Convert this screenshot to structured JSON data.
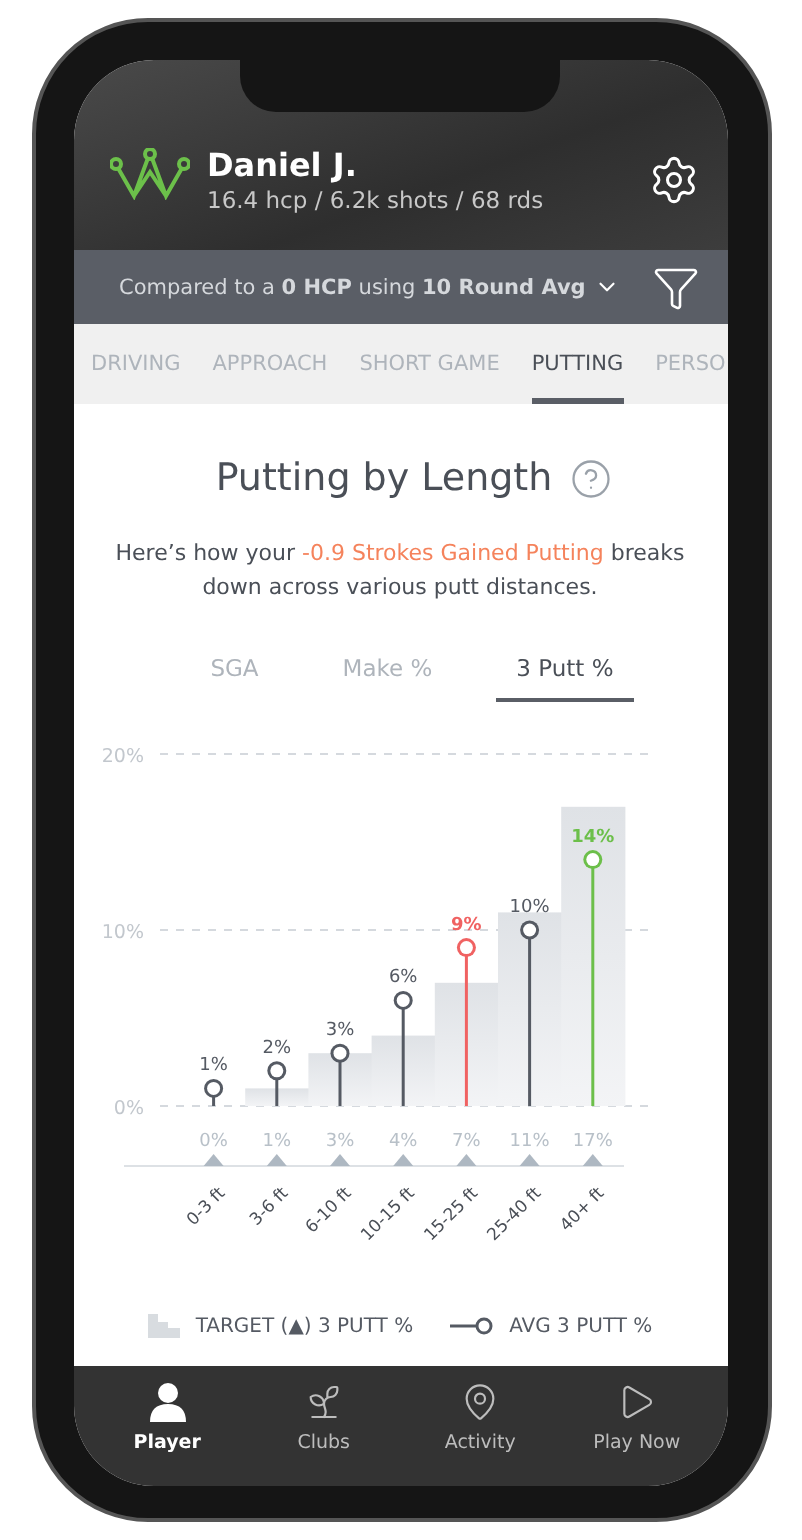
{
  "header": {
    "name": "Daniel J.",
    "stats": "16.4 hcp / 6.2k shots / 68 rds"
  },
  "comparison": {
    "text": "Compared to a **0 HCP** using **10 Round Avg**"
  },
  "tabs": [
    {
      "label": "DRIVING",
      "selected": false
    },
    {
      "label": "APPROACH",
      "selected": false
    },
    {
      "label": "SHORT GAME",
      "selected": false
    },
    {
      "label": "PUTTING",
      "selected": true
    },
    {
      "label": "PERSO",
      "selected": false
    }
  ],
  "section": {
    "title": "Putting by Length",
    "description": "Here’s how your **-0.9 Strokes Gained Putting** breaks down across various putt distances."
  },
  "metric_tabs": [
    {
      "label": "SGA",
      "selected": false
    },
    {
      "label": "Make %",
      "selected": false
    },
    {
      "label": "3 Putt %",
      "selected": true
    }
  ],
  "chart_data": {
    "type": "bar",
    "categories": [
      "0-3 ft",
      "3-6 ft",
      "6-10 ft",
      "10-15 ft",
      "15-25 ft",
      "25-40 ft",
      "40+ ft"
    ],
    "ylim": [
      0,
      20
    ],
    "yticks": [
      {
        "value": 0,
        "label": "0%"
      },
      {
        "value": 10,
        "label": "10%"
      },
      {
        "value": 20,
        "label": "20%"
      }
    ],
    "series": [
      {
        "name": "TARGET (▲) 3 PUTT %",
        "color": "#dfe2e6",
        "values": [
          0,
          1,
          3,
          4,
          7,
          11,
          17
        ],
        "value_labels": [
          "0%",
          "1%",
          "3%",
          "4%",
          "7%",
          "11%",
          "17%"
        ]
      },
      {
        "name": "AVG 3 PUTT %",
        "type": "scatter",
        "colors": [
          "#555a63",
          "#555a63",
          "#555a63",
          "#555a63",
          "#f06262",
          "#555a63",
          "#6cbf4a"
        ],
        "values": [
          1,
          2,
          3,
          6,
          9,
          10,
          14
        ],
        "value_labels": [
          "1%",
          "2%",
          "3%",
          "6%",
          "9%",
          "10%",
          "14%"
        ]
      }
    ]
  },
  "avg_markers": [
    {
      "highlighted": false
    },
    {
      "highlighted": false
    },
    {
      "highlighted": false
    },
    {
      "highlighted": false
    },
    {
      "highlighted": true
    },
    {
      "highlighted": false
    },
    {
      "highlighted": true
    }
  ],
  "nav": [
    {
      "label": "Player",
      "selected": true,
      "kind": "player"
    },
    {
      "label": "Clubs",
      "selected": false,
      "kind": "clubs"
    },
    {
      "label": "Activity",
      "selected": false,
      "kind": "activity"
    },
    {
      "label": "Play Now",
      "selected": false,
      "kind": "play"
    }
  ]
}
